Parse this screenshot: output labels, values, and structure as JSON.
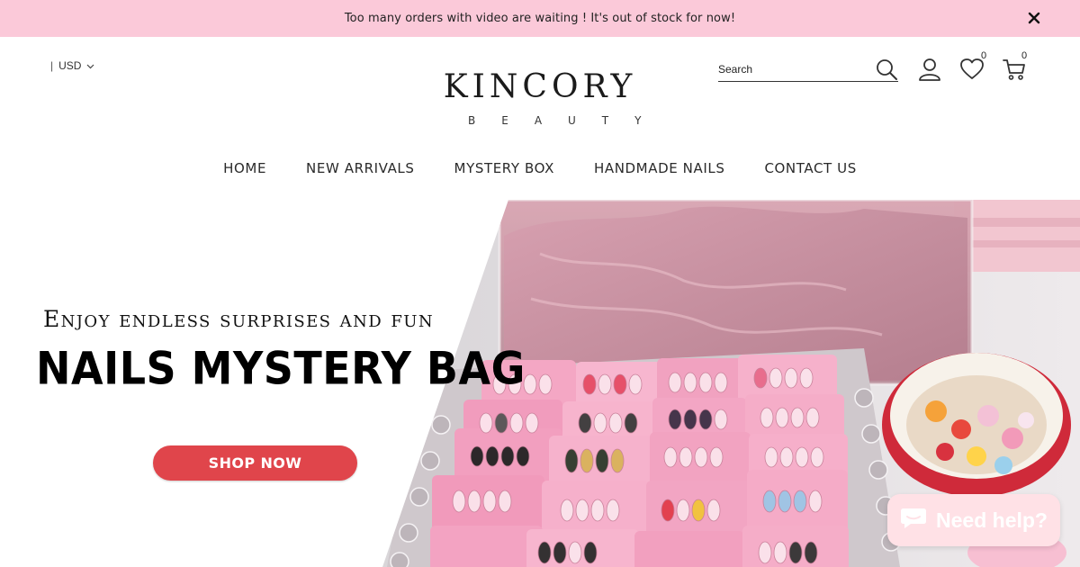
{
  "announcement": {
    "text": "Too many orders with video are waiting ! It's out of stock for now!",
    "close_icon": "close-icon"
  },
  "header": {
    "currency": {
      "separator": "|",
      "value": "USD"
    },
    "logo": {
      "main": "KINCORY",
      "sub": "BEAUTY"
    },
    "search": {
      "placeholder": "Search"
    },
    "wishlist_count": "0",
    "cart_count": "0"
  },
  "nav": {
    "items": [
      {
        "label": "HOME"
      },
      {
        "label": "NEW ARRIVALS"
      },
      {
        "label": "MYSTERY BOX"
      },
      {
        "label": "HANDMADE NAILS"
      },
      {
        "label": "CONTACT US"
      }
    ]
  },
  "hero": {
    "subtitle": "Enjoy endless surprises and fun",
    "title": "NAILS MYSTERY BAG",
    "cta_label": "SHOP NOW"
  },
  "chat": {
    "label": "Need help?"
  },
  "colors": {
    "announcement_bg": "#fbc9d9",
    "cta_red": "#e0454b",
    "chat_bg": "#ffe1e6"
  }
}
